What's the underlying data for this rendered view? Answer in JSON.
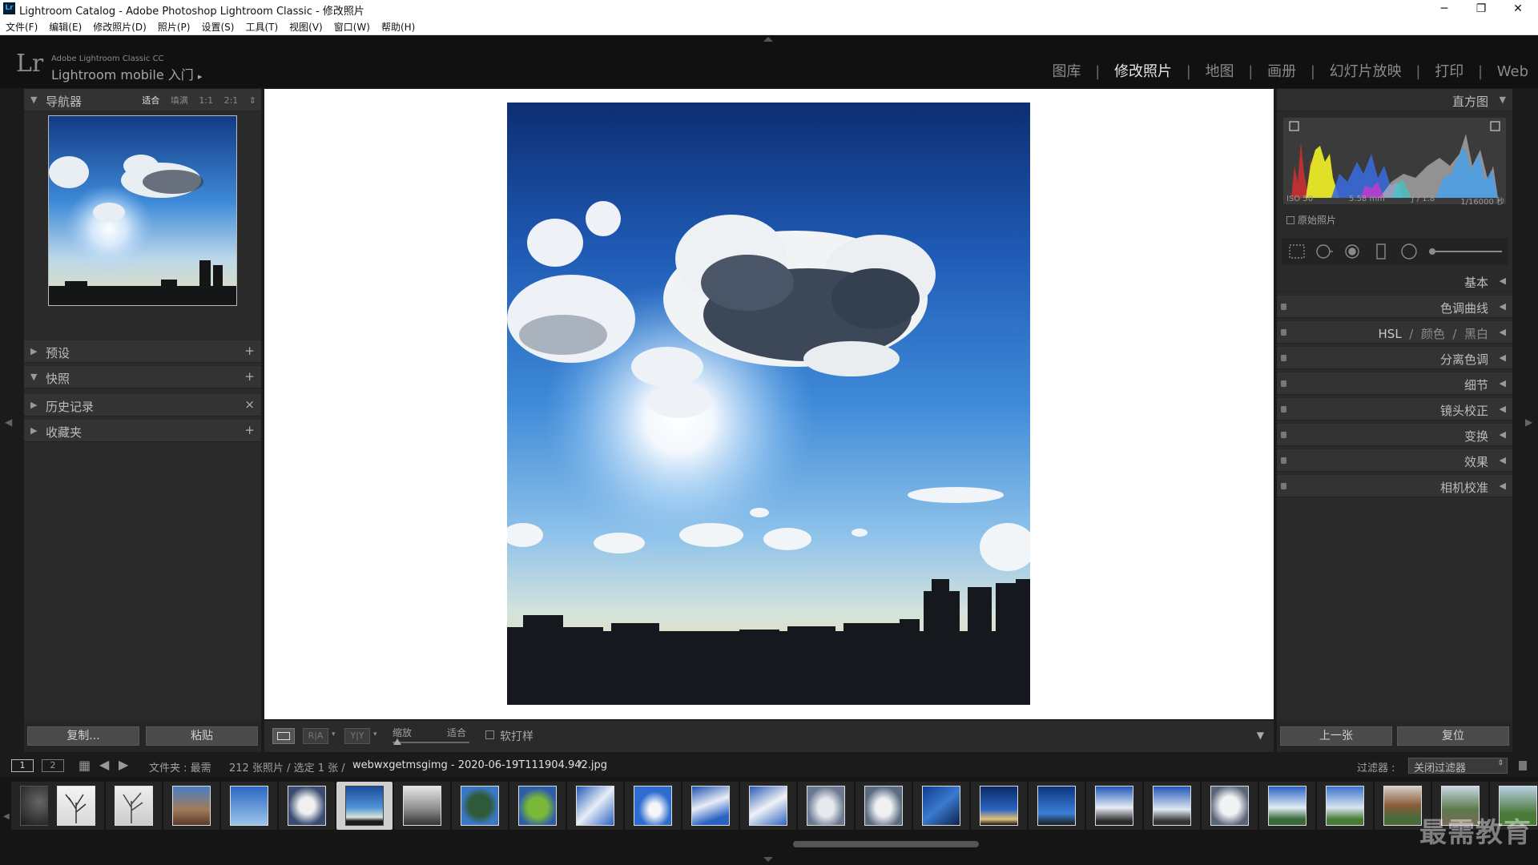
{
  "window": {
    "app_icon": "Lr",
    "title": "Lightroom Catalog - Adobe Photoshop Lightroom Classic - 修改照片",
    "minimize": "─",
    "maximize": "❐",
    "close": "✕"
  },
  "menu": [
    "文件(F)",
    "编辑(E)",
    "修改照片(D)",
    "照片(P)",
    "设置(S)",
    "工具(T)",
    "视图(V)",
    "窗口(W)",
    "帮助(H)"
  ],
  "identity": {
    "logo": "Lr",
    "subtitle": "Adobe Lightroom Classic CC",
    "mobile": "Lightroom mobile 入门",
    "arrow": "▸"
  },
  "modules": [
    {
      "label": "图库",
      "active": false
    },
    {
      "label": "修改照片",
      "active": true
    },
    {
      "label": "地图",
      "active": false
    },
    {
      "label": "画册",
      "active": false
    },
    {
      "label": "幻灯片放映",
      "active": false
    },
    {
      "label": "打印",
      "active": false
    },
    {
      "label": "Web",
      "active": false
    }
  ],
  "left_panel": {
    "navigator": {
      "label": "导航器",
      "modes": [
        "适合",
        "填满",
        "1:1",
        "2:1"
      ],
      "active_mode": "适合",
      "mode_arrow": "⇕"
    },
    "sections": [
      {
        "label": "预设",
        "action": "+",
        "expanded": false
      },
      {
        "label": "快照",
        "action": "+",
        "expanded": true
      },
      {
        "label": "历史记录",
        "action": "×",
        "expanded": false
      },
      {
        "label": "收藏夹",
        "action": "+",
        "expanded": false
      }
    ],
    "copy_button": "复制...",
    "paste_button": "粘贴"
  },
  "right_panel": {
    "histogram_label": "直方图",
    "histogram_info": {
      "iso": "ISO 50",
      "focal": "5.58 mm",
      "aperture": "ƒ / 1.8",
      "shutter": "1/16000 秒"
    },
    "original_photo": "原始照片",
    "sections": [
      "基本",
      "色调曲线",
      "HSL",
      "颜色",
      "黑白",
      "分离色调",
      "细节",
      "镜头校正",
      "变换",
      "效果",
      "相机校准"
    ],
    "prev_button": "上一张",
    "reset_button": "复位"
  },
  "toolbar": {
    "zoom_label": "缩放",
    "zoom_value": "适合",
    "softproof": "软打样",
    "ry_a": "R|A",
    "ry_b": "Y|Y"
  },
  "filmstrip_bar": {
    "page1": "1",
    "page2": "2",
    "folder_label": "文件夹 : 最需",
    "count": "212 张照片 / 选定 1 张 /",
    "filename": "webwxgetmsgimg - 2020-06-19T111904.942.jpg",
    "filter_label": "过滤器 :",
    "filter_value": "关闭过滤器"
  },
  "watermark": "最需教育",
  "colors": {
    "accent": "#e6e6e6",
    "panel": "#2a2a2a",
    "sky": "#2f6cc2"
  }
}
